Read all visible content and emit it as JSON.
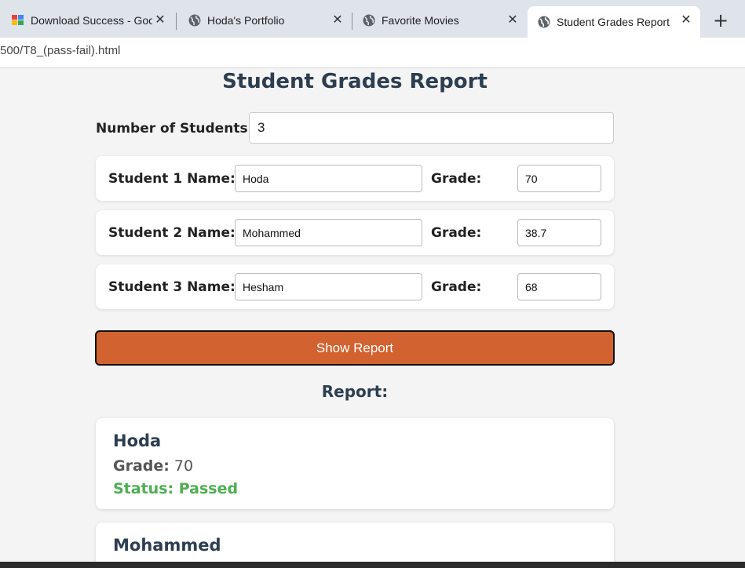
{
  "browser": {
    "tabs": [
      {
        "title": "Download Success - Goog",
        "favicon": "google-colorful-icon",
        "active": false
      },
      {
        "title": "Hoda's Portfolio",
        "favicon": "globe-icon",
        "active": false
      },
      {
        "title": "Favorite Movies",
        "favicon": "globe-icon",
        "active": false
      },
      {
        "title": "Student Grades Report",
        "favicon": "globe-icon",
        "active": true
      }
    ],
    "close_glyph": "✕",
    "new_tab_glyph": "+",
    "address": "500/T8_(pass-fail).html"
  },
  "page": {
    "title": "Student Grades Report",
    "count_label": "Number of Students:",
    "count_value": "3",
    "grade_label": "Grade:",
    "students": [
      {
        "name_label": "Student 1 Name:",
        "name": "Hoda",
        "grade": "70"
      },
      {
        "name_label": "Student 2 Name:",
        "name": "Mohammed",
        "grade": "38.7"
      },
      {
        "name_label": "Student 3 Name:",
        "name": "Hesham",
        "grade": "68"
      }
    ],
    "show_button": "Show Report",
    "report_heading": "Report:",
    "report": [
      {
        "name": "Hoda",
        "grade_label": "Grade:",
        "grade": "70",
        "status": "Status: Passed"
      },
      {
        "name": "Mohammed"
      }
    ]
  },
  "colors": {
    "accent_button": "#d2622f",
    "heading": "#2c3e50",
    "passed": "#4caf50"
  }
}
